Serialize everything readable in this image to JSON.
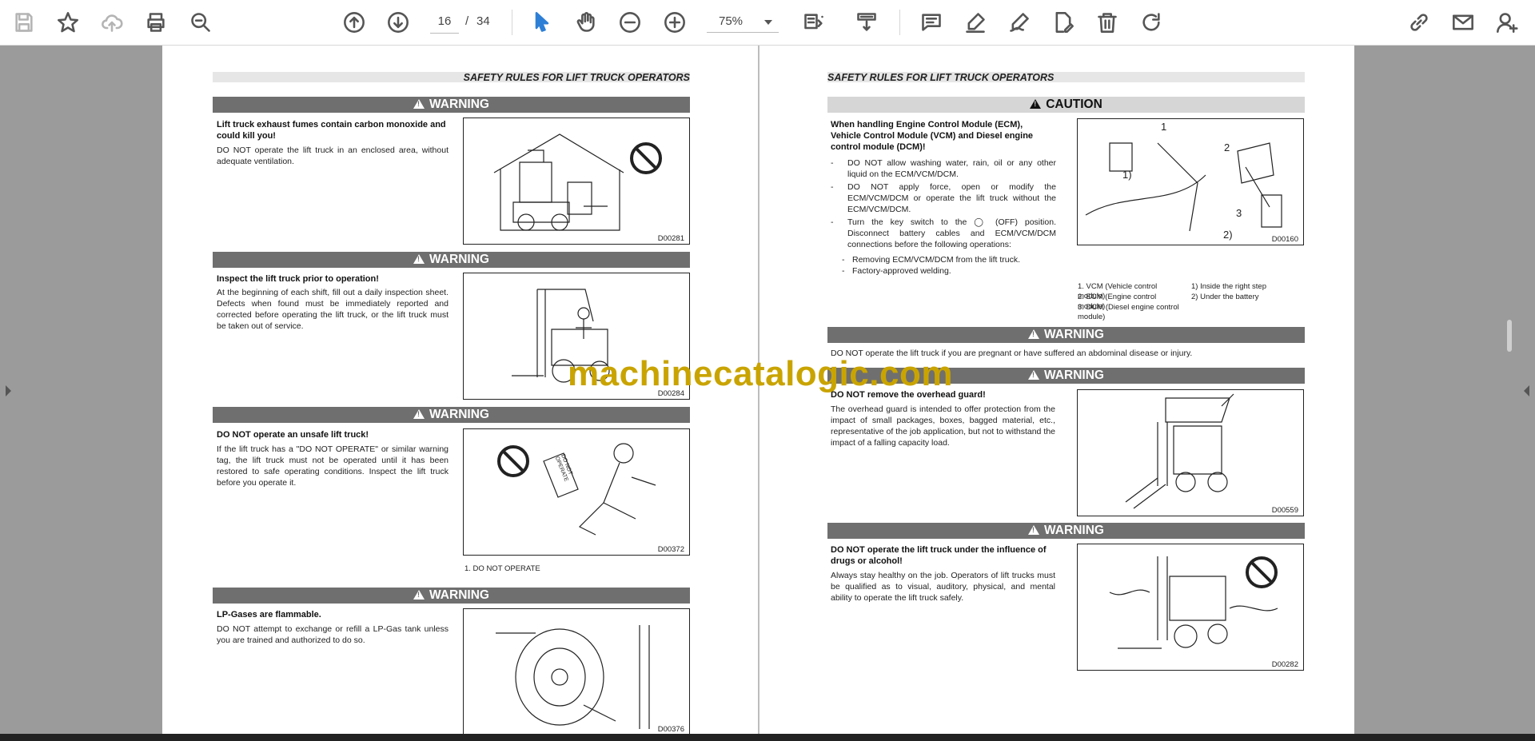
{
  "toolbar": {
    "icons": [
      "save-icon",
      "bookmark-star-icon",
      "cloud-upload-icon",
      "print-icon",
      "find-zoom-icon",
      "previous-page-icon",
      "next-page-icon",
      "select-cursor-icon",
      "hand-pan-icon",
      "zoom-out-icon",
      "zoom-in-icon",
      "page-fit-icon",
      "scroll-mode-icon",
      "comment-icon",
      "highlight-icon",
      "sign-icon",
      "edit-pdf-icon",
      "delete-icon",
      "rotate-icon",
      "share-link-icon",
      "email-icon",
      "account-icon"
    ],
    "current_page": "16",
    "page_sep": "/",
    "total_pages": "34",
    "zoom": "75%"
  },
  "left_page": {
    "running_head": "SAFETY RULES FOR LIFT TRUCK OPERATORS",
    "sections": [
      {
        "band": "WARNING",
        "heading": "Lift truck exhaust fumes contain carbon monoxide and could kill you!",
        "body": "DO NOT operate the lift truck in an enclosed area, without adequate ventilation.",
        "figure_code": "D00281"
      },
      {
        "band": "WARNING",
        "heading": "Inspect the lift truck prior to operation!",
        "body": "At the beginning of each shift, fill out a daily inspection sheet. Defects when found must be immediately reported and corrected before operating the lift truck, or the lift truck must be taken out of service.",
        "figure_code": "D00284"
      },
      {
        "band": "WARNING",
        "heading": "DO NOT operate an unsafe lift truck!",
        "body": "If the lift truck has a \"DO NOT OPERATE\" or similar warning tag, the lift truck must not be operated until it has been restored to safe operating conditions. Inspect the lift truck before you operate it.",
        "figure_code": "D00372",
        "caption": "1. DO NOT OPERATE"
      },
      {
        "band": "WARNING",
        "heading": "LP-Gases are flammable.",
        "body": "DO NOT attempt to exchange or refill a LP-Gas tank unless you are trained and authorized to do so.",
        "figure_code": "D00376"
      }
    ]
  },
  "right_page": {
    "running_head": "SAFETY RULES FOR LIFT TRUCK OPERATORS",
    "caution": {
      "band": "CAUTION",
      "heading": "When handling Engine Control Module (ECM), Vehicle Control Module (VCM) and Diesel engine control module (DCM)!",
      "bullets": [
        "DO NOT allow washing water, rain, oil or any other liquid on the ECM/VCM/DCM.",
        "DO NOT apply force, open or modify the ECM/VCM/DCM or operate the lift truck without the ECM/VCM/DCM.",
        "Turn the key switch to the ◯ (OFF) position. Disconnect battery cables and ECM/VCM/DCM connections before the following operations:"
      ],
      "subbullets": [
        "Removing ECM/VCM/DCM from the lift truck.",
        "Factory-approved welding."
      ],
      "figure_code": "D00160",
      "callouts": [
        "1",
        "2",
        "3",
        "1)",
        "2)"
      ],
      "legend_left": [
        "1. VCM (Vehicle control module)",
        "2. ECM (Engine control module)",
        "3. DCM (Diesel engine control module)"
      ],
      "legend_right": [
        "1) Inside the right step",
        "2) Under the battery"
      ]
    },
    "warning_pregnant": {
      "band": "WARNING",
      "body": "DO NOT operate the lift truck if you are pregnant or have suffered an abdominal disease or injury."
    },
    "warning_guard": {
      "band": "WARNING",
      "heading": "DO NOT remove the overhead guard!",
      "body": "The overhead guard is intended to offer protection from the impact of small packages, boxes, bagged material, etc., representative of the job application, but not to withstand the impact of a falling capacity load.",
      "figure_code": "D00559"
    },
    "warning_drugs": {
      "band": "WARNING",
      "heading": "DO NOT operate the lift truck under the influence of drugs or alcohol!",
      "body": "Always stay healthy on the job. Operators of lift trucks must be qualified as to visual, auditory, physical, and mental ability to operate the lift truck safely.",
      "figure_code": "D00282"
    }
  },
  "figure_texts": {
    "do_not_operate_tag": "DO NOT OPERATE"
  },
  "watermark": "machinecatalogic.com",
  "colors": {
    "toolbar_bg": "#ffffff",
    "viewer_bg": "#9b9b9b",
    "band_dark": "#6f6f6f",
    "band_light": "#d6d6d6",
    "watermark": "#c9a400",
    "select_tool": "#2d7fd6"
  }
}
